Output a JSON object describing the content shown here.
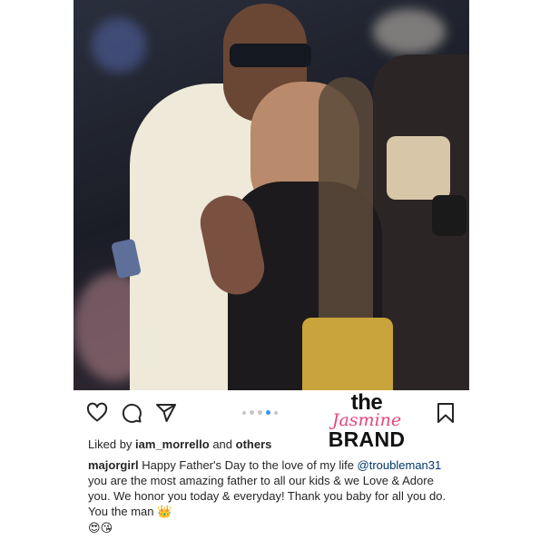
{
  "post": {
    "likes": {
      "prefix": "Liked by ",
      "user": "iam_morrello",
      "middle": " and ",
      "others": "others"
    },
    "caption": {
      "username": "majorgirl",
      "text_1": " Happy Father's Day to the love of my life ",
      "mention": "@troubleman31",
      "text_2": " you are the most amazing father to all our kids & we Love & Adore you. We honor you today & everyday! Thank you baby for all you do. You the man ",
      "emoji_crown": "👑",
      "emoji_heart_eyes": "😍",
      "emoji_kiss": "😘"
    },
    "carousel": {
      "dot_count": 5,
      "active_index": 3
    },
    "icons": {
      "like": "heart-icon",
      "comment": "comment-icon",
      "share": "share-icon",
      "save": "bookmark-icon"
    }
  },
  "watermark": {
    "line1": "the",
    "line2": "Jasmine",
    "line3": "BRAND"
  },
  "colors": {
    "text": "#262626",
    "mention": "#00376b",
    "active_dot": "#3897f0",
    "brand_pink": "#e8437d"
  }
}
